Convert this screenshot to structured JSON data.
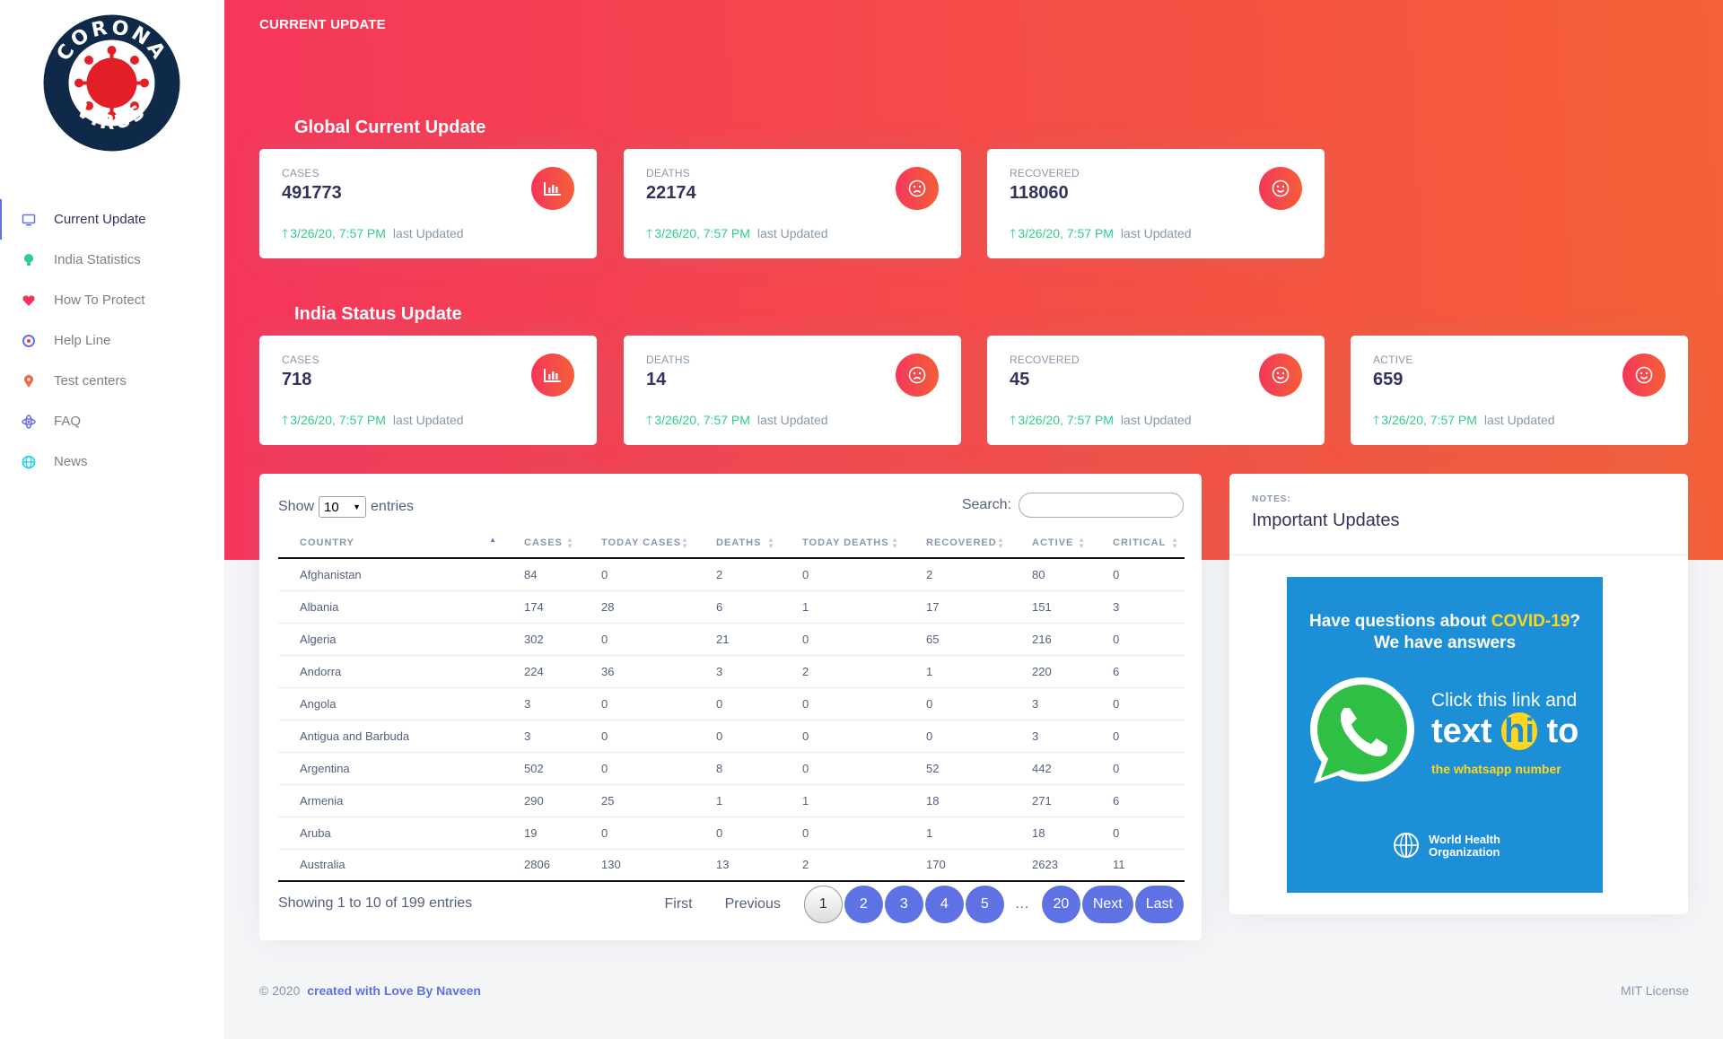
{
  "app": {
    "logo_text_top": "CORONA",
    "logo_text_bottom": "VIRUS",
    "header_title": "CURRENT UPDATE"
  },
  "sidebar": {
    "items": [
      {
        "label": "Current Update",
        "icon": "desktop-icon",
        "color": "#5e72e4"
      },
      {
        "label": "India Statistics",
        "icon": "bulb-icon",
        "color": "#2dce89"
      },
      {
        "label": "How To Protect",
        "icon": "heart-icon",
        "color": "#f5365c"
      },
      {
        "label": "Help Line",
        "icon": "support-icon",
        "color": "#5e72e4"
      },
      {
        "label": "Test centers",
        "icon": "pin-icon",
        "color": "#fb6340"
      },
      {
        "label": "FAQ",
        "icon": "atom-icon",
        "color": "#5e72e4"
      },
      {
        "label": "News",
        "icon": "globe-icon",
        "color": "#11cdef"
      }
    ]
  },
  "global": {
    "title": "Global Current Update",
    "cards": [
      {
        "label": "CASES",
        "value": "491773",
        "date": "3/26/20, 7:57 PM",
        "note": "last Updated",
        "icon": "chart-bar-icon"
      },
      {
        "label": "DEATHS",
        "value": "22174",
        "date": "3/26/20, 7:57 PM",
        "note": "last Updated",
        "icon": "sad-face-icon"
      },
      {
        "label": "RECOVERED",
        "value": "118060",
        "date": "3/26/20, 7:57 PM",
        "note": "last Updated",
        "icon": "smile-face-icon"
      }
    ]
  },
  "india": {
    "title": "India Status Update",
    "cards": [
      {
        "label": "CASES",
        "value": "718",
        "date": "3/26/20, 7:57 PM",
        "note": "last Updated",
        "icon": "chart-bar-icon"
      },
      {
        "label": "DEATHS",
        "value": "14",
        "date": "3/26/20, 7:57 PM",
        "note": "last Updated",
        "icon": "sad-face-icon"
      },
      {
        "label": "RECOVERED",
        "value": "45",
        "date": "3/26/20, 7:57 PM",
        "note": "last Updated",
        "icon": "smile-face-icon"
      },
      {
        "label": "ACTIVE",
        "value": "659",
        "date": "3/26/20, 7:57 PM",
        "note": "last Updated",
        "icon": "smile-face-icon"
      }
    ]
  },
  "table": {
    "show_label": "Show",
    "entries_label": "entries",
    "page_size": "10",
    "search_label": "Search:",
    "search_value": "",
    "columns": [
      "COUNTRY",
      "CASES",
      "TODAY CASES",
      "DEATHS",
      "TODAY DEATHS",
      "RECOVERED",
      "ACTIVE",
      "CRITICAL"
    ],
    "rows": [
      [
        "Afghanistan",
        "84",
        "0",
        "2",
        "0",
        "2",
        "80",
        "0"
      ],
      [
        "Albania",
        "174",
        "28",
        "6",
        "1",
        "17",
        "151",
        "3"
      ],
      [
        "Algeria",
        "302",
        "0",
        "21",
        "0",
        "65",
        "216",
        "0"
      ],
      [
        "Andorra",
        "224",
        "36",
        "3",
        "2",
        "1",
        "220",
        "6"
      ],
      [
        "Angola",
        "3",
        "0",
        "0",
        "0",
        "0",
        "3",
        "0"
      ],
      [
        "Antigua and Barbuda",
        "3",
        "0",
        "0",
        "0",
        "0",
        "3",
        "0"
      ],
      [
        "Argentina",
        "502",
        "0",
        "8",
        "0",
        "52",
        "442",
        "0"
      ],
      [
        "Armenia",
        "290",
        "25",
        "1",
        "1",
        "18",
        "271",
        "6"
      ],
      [
        "Aruba",
        "19",
        "0",
        "0",
        "0",
        "1",
        "18",
        "0"
      ],
      [
        "Australia",
        "2806",
        "130",
        "13",
        "2",
        "170",
        "2623",
        "11"
      ]
    ],
    "info": "Showing 1 to 10 of 199 entries",
    "pagination": {
      "first": "First",
      "previous": "Previous",
      "pages": [
        "1",
        "2",
        "3",
        "4",
        "5"
      ],
      "ellipsis": "…",
      "last_page": "20",
      "next": "Next",
      "last": "Last",
      "current": "1"
    }
  },
  "notes": {
    "label": "NOTES:",
    "title": "Important Updates",
    "banner": {
      "question_a": "Have questions about ",
      "question_highlight": "COVID-19",
      "question_b": "?",
      "answer": "We have answers",
      "click": "Click this link and",
      "text_a": "text ",
      "text_hi": "hi",
      "text_b": " to",
      "sub": "the whatsapp number",
      "org_line1": "World Health",
      "org_line2": "Organization"
    }
  },
  "footer": {
    "copyright": "© 2020",
    "credit": "created with Love By Naveen",
    "license": "MIT License"
  },
  "colors": {
    "primary": "#5e72e4",
    "gradient_start": "#f5365c",
    "gradient_end": "#f56036",
    "success": "#2dce89"
  }
}
